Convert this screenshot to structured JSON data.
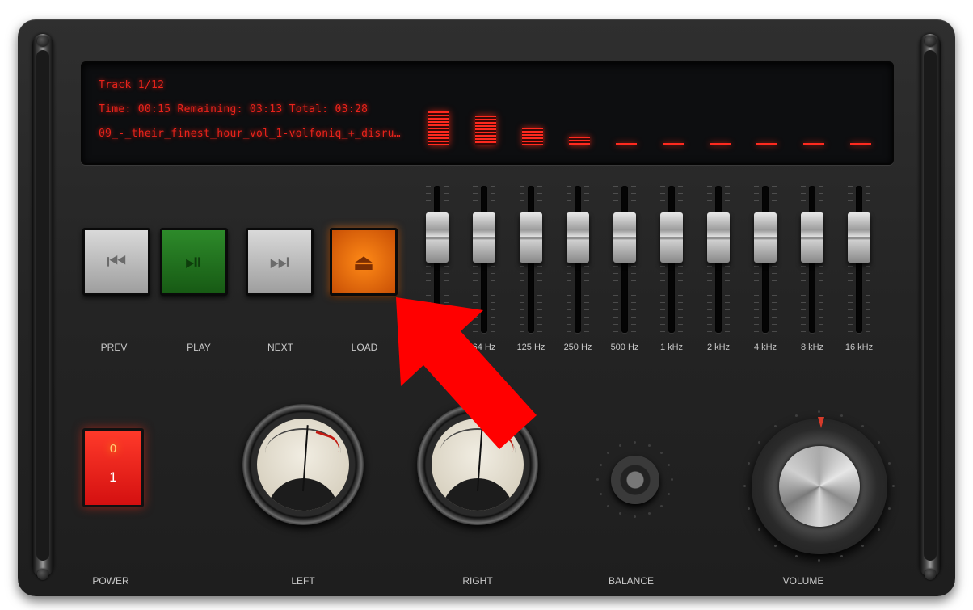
{
  "display": {
    "track": "Track 1/12",
    "time": "Time: 00:15  Remaining: 03:13  Total: 03:28",
    "title": "09_-_their_finest_hour_vol_1-volfoniq_+_disru…",
    "spectrum_levels": [
      0.95,
      0.85,
      0.5,
      0.25,
      0.05,
      0.05,
      0.05,
      0.05,
      0.05,
      0.05
    ]
  },
  "transport": {
    "prev": "PREV",
    "play": "PLAY",
    "next": "NEXT",
    "load": "LOAD",
    "prev_icon": "skip-back-icon",
    "play_icon": "play-pause-icon",
    "next_icon": "skip-forward-icon",
    "load_icon": "eject-icon"
  },
  "equalizer": {
    "bands": [
      "",
      "64 Hz",
      "125 Hz",
      "250 Hz",
      "500 Hz",
      "1 kHz",
      "2 kHz",
      "4 kHz",
      "8 kHz",
      "16 kHz"
    ],
    "levels": [
      0.82,
      0.82,
      0.82,
      0.82,
      0.82,
      0.82,
      0.82,
      0.82,
      0.82,
      0.82
    ]
  },
  "power": {
    "label": "POWER",
    "off_symbol": "0",
    "on_symbol": "1"
  },
  "meters": {
    "left": "LEFT",
    "right": "RIGHT"
  },
  "balance": {
    "label": "BALANCE"
  },
  "volume": {
    "label": "VOLUME"
  },
  "colors": {
    "lcd": "#e8231b",
    "annotation_arrow": "#ff0000"
  }
}
